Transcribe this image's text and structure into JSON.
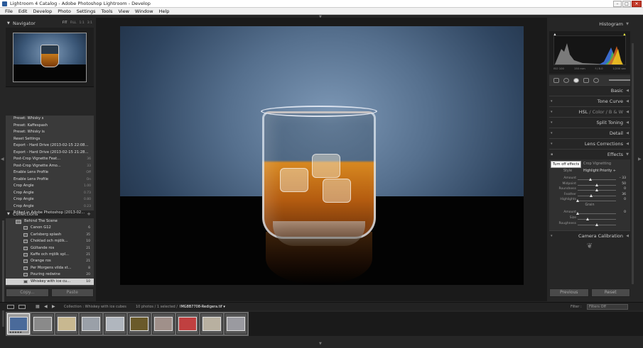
{
  "window": {
    "title": "Lightroom 4 Catalog - Adobe Photoshop Lightroom - Develop",
    "minimize": "–",
    "maximize": "□",
    "close": "✕"
  },
  "menu": [
    "File",
    "Edit",
    "Develop",
    "Photo",
    "Settings",
    "Tools",
    "View",
    "Window",
    "Help"
  ],
  "navigator": {
    "title": "Navigator",
    "zoom": [
      "FIT",
      "FILL",
      "1:1",
      "3:1"
    ]
  },
  "history": [
    {
      "label": "Preset: Whisky s",
      "value": ""
    },
    {
      "label": "Preset: Kaffespash",
      "value": ""
    },
    {
      "label": "Preset: Whisky is",
      "value": ""
    },
    {
      "label": "Reset Settings",
      "value": ""
    },
    {
      "label": "Export - Hard Drive (2013-02-15 22:08...",
      "value": ""
    },
    {
      "label": "Export - Hard Drive (2013-02-15 21:28...",
      "value": ""
    },
    {
      "label": "Post-Crop Vignette Feat...",
      "value": "36"
    },
    {
      "label": "Post-Crop Vignette Amo...",
      "value": "33"
    },
    {
      "label": "Enable Lens Profile",
      "value": "Off"
    },
    {
      "label": "Enable Lens Profile",
      "value": "On"
    },
    {
      "label": "Crop Angle",
      "value": "1.00"
    },
    {
      "label": "Crop Angle",
      "value": "0.73"
    },
    {
      "label": "Crop Angle",
      "value": "0.80"
    },
    {
      "label": "Crop Angle",
      "value": "0.23"
    },
    {
      "label": "Edited in Adobe Photoshop (2013-02...",
      "value": ""
    }
  ],
  "collections": {
    "title": "Collections",
    "add": "+",
    "items": [
      {
        "label": "Behind The Scene",
        "count": "",
        "type": "set"
      },
      {
        "label": "Canon G12",
        "count": "6",
        "type": "item"
      },
      {
        "label": "Carlsberg splash",
        "count": "35",
        "type": "item"
      },
      {
        "label": "Choklad och mjölk...",
        "count": "10",
        "type": "item"
      },
      {
        "label": "Gültande ros",
        "count": "21",
        "type": "item"
      },
      {
        "label": "Kaffe och mjölk spl...",
        "count": "21",
        "type": "item"
      },
      {
        "label": "Orange ros",
        "count": "21",
        "type": "item"
      },
      {
        "label": "Per Morgens vilda st...",
        "count": "8",
        "type": "item"
      },
      {
        "label": "Pouring redwine",
        "count": "20",
        "type": "item"
      },
      {
        "label": "Whiskey with ice cu...",
        "count": "10",
        "type": "selected"
      }
    ]
  },
  "left_buttons": {
    "copy": "Copy...",
    "paste": "Paste"
  },
  "histogram": {
    "title": "Histogram",
    "meta": [
      "ISO 100",
      "150 mm",
      "f / 8.0",
      "1/200 sec"
    ],
    "clip_shadow": "▲",
    "clip_highlight": "▲"
  },
  "panels": {
    "basic": "Basic",
    "tone_curve": "Tone Curve",
    "hsl": "HSL",
    "color": "Color",
    "bw": "B & W",
    "split_toning": "Split Toning",
    "detail": "Detail",
    "lens": "Lens Corrections",
    "effects": "Effects",
    "camera": "Camera Calibration"
  },
  "effects": {
    "tooltip": "Turn off effects",
    "section": "Crop Vignetting",
    "style_label": "Style",
    "style_value": "Highlight Priority ÷",
    "grain": "Grain",
    "sliders": [
      {
        "label": "Amount",
        "value": "– 33",
        "pos": 0.33
      },
      {
        "label": "Midpoint",
        "value": "50",
        "pos": 0.5
      },
      {
        "label": "Roundness",
        "value": "0",
        "pos": 0.5
      },
      {
        "label": "Feather",
        "value": "36",
        "pos": 0.36
      },
      {
        "label": "Highlights",
        "value": "0",
        "pos": 0.0
      }
    ],
    "grain_sliders": [
      {
        "label": "Amount",
        "value": "0",
        "pos": 0.0
      },
      {
        "label": "Size",
        "value": "",
        "pos": 0.25
      },
      {
        "label": "Roughness",
        "value": "",
        "pos": 0.5
      }
    ]
  },
  "right_buttons": {
    "previous": "Previous",
    "reset": "Reset"
  },
  "filmstrip_bar": {
    "path": "Collection : Whiskey with ice cubes",
    "count": "10 photos / 1 selected /",
    "file": "IMG8B7708-Redigera.tif",
    "file_suffix": "▾",
    "filter_label": "Filter :",
    "filter_value": "Filters Off"
  },
  "filmstrip": {
    "thumbs": [
      {
        "stars": "★★★★★",
        "color": "#4a6a9a"
      },
      {
        "stars": "",
        "color": "#8a8a8a"
      },
      {
        "stars": "",
        "color": "#c8b890"
      },
      {
        "stars": "",
        "color": "#9aa0a8"
      },
      {
        "stars": "",
        "color": "#b0b6be"
      },
      {
        "stars": "",
        "color": "#6a5a2a"
      },
      {
        "stars": "",
        "color": "#a0908a"
      },
      {
        "stars": "",
        "color": "#c04040"
      },
      {
        "stars": "",
        "color": "#b8b0a0"
      },
      {
        "stars": "",
        "color": "#9a9aa0"
      }
    ]
  }
}
